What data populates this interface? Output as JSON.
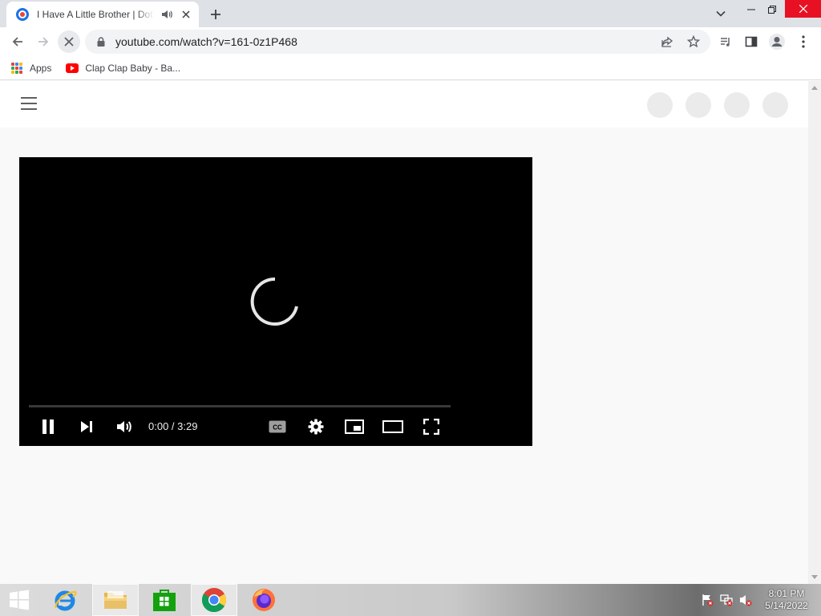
{
  "browser": {
    "tab": {
      "title": "I Have A Little Brother | Dotty",
      "audio_icon": "speaker-icon",
      "close_icon": "close-icon"
    },
    "new_tab_icon": "plus-icon",
    "address": {
      "url": "youtube.com/watch?v=161-0z1P468",
      "secure_icon": "lock-icon"
    },
    "bookmarks": [
      {
        "label": "Apps",
        "icon": "apps-grid-icon"
      },
      {
        "label": "Clap Clap Baby - Ba...",
        "icon": "youtube-icon"
      }
    ]
  },
  "player": {
    "time_display": "0:00 / 3:29",
    "state": "loading",
    "progress_fraction": 0.0,
    "controls": [
      "pause",
      "next",
      "volume",
      "captions",
      "settings",
      "miniplayer",
      "theater",
      "fullscreen"
    ]
  },
  "taskbar": {
    "pinned": [
      "start",
      "internet-explorer",
      "file-explorer",
      "store",
      "chrome",
      "firefox"
    ],
    "active": "chrome",
    "clock": {
      "time": "8:01 PM",
      "date": "5/14/2022"
    }
  },
  "colors": {
    "tab_strip": "#dee1e6",
    "close_red": "#e81123",
    "youtube_red": "#ff0000",
    "page_bg": "#f9f9f9",
    "player_bg": "#000000"
  }
}
